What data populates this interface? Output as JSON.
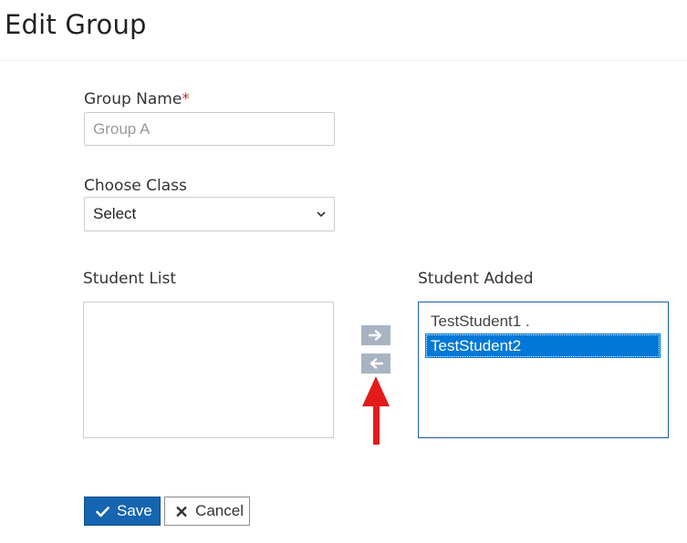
{
  "page": {
    "title": "Edit Group"
  },
  "form": {
    "group_name": {
      "label": "Group Name",
      "required_mark": "*",
      "placeholder": "Group A",
      "value": ""
    },
    "choose_class": {
      "label": "Choose Class",
      "selected": "Select"
    },
    "student_list": {
      "label": "Student List",
      "items": []
    },
    "student_added": {
      "label": "Student Added",
      "items": [
        {
          "label": "TestStudent1 .",
          "selected": false
        },
        {
          "label": "TestStudent2",
          "selected": true
        }
      ]
    },
    "move_right_icon": "arrow-right-icon",
    "move_left_icon": "arrow-left-icon"
  },
  "actions": {
    "save_label": "Save",
    "cancel_label": "Cancel"
  },
  "colors": {
    "primary": "#1565b0",
    "selection": "#0078d7",
    "move_button": "#a8b4c2",
    "annotation_arrow": "#e31b1b",
    "required": "#c0392b"
  }
}
